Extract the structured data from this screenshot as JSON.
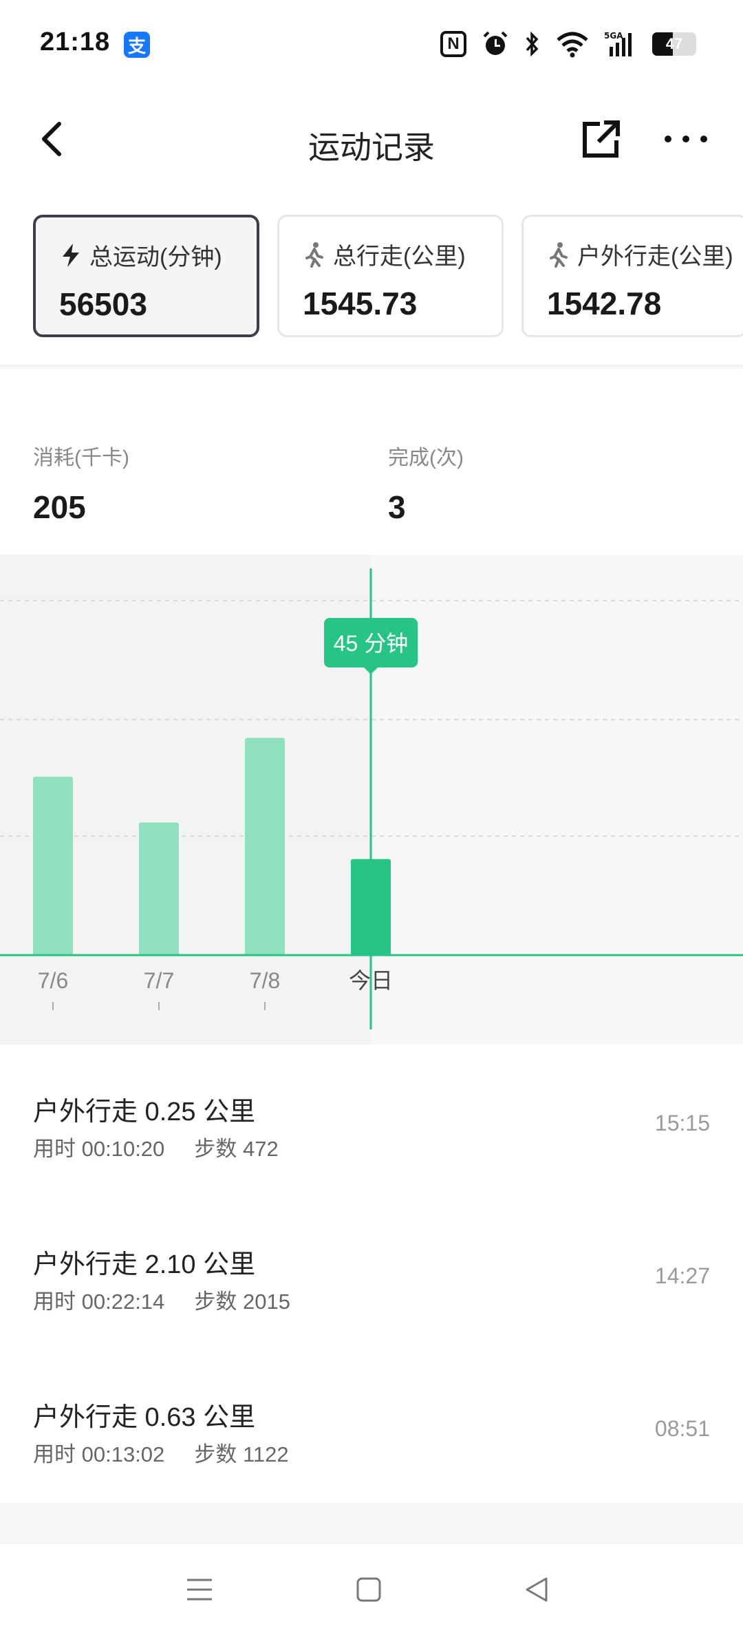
{
  "status_bar": {
    "time": "21:18",
    "app_badge": "支",
    "battery": "47",
    "battery_level": 0.47,
    "icons": [
      "nfc-icon",
      "alarm-icon",
      "bluetooth-icon",
      "wifi-icon",
      "signal-5g-icon",
      "battery-icon"
    ]
  },
  "header": {
    "title": "运动记录",
    "back_icon": "chevron-left-icon",
    "share_icon": "share-icon",
    "more_icon": "more-icon"
  },
  "cards": [
    {
      "icon": "lightning-icon",
      "label": "总运动(分钟)",
      "value": "56503",
      "selected": true
    },
    {
      "icon": "walk-icon",
      "label": "总行走(公里)",
      "value": "1545.73",
      "selected": false
    },
    {
      "icon": "walk-icon",
      "label": "户外行走(公里)",
      "value": "1542.78",
      "selected": false
    }
  ],
  "scrolled_value": "45",
  "metrics": [
    {
      "label": "消耗(千卡)",
      "value": "205"
    },
    {
      "label": "完成(次)",
      "value": "3"
    }
  ],
  "colors": {
    "accent": "#26c586",
    "bar_light": "#8fe0be",
    "text_primary": "#1a1a1a",
    "text_secondary": "#888888"
  },
  "chart_data": {
    "type": "bar",
    "categories": [
      "7/6",
      "7/7",
      "7/8",
      "今日"
    ],
    "values": [
      78,
      58,
      95,
      42
    ],
    "selected_index": 3,
    "tooltip": "45 分钟",
    "ylim": [
      0,
      145
    ],
    "gridlines": [
      52,
      103,
      155
    ],
    "grid": true
  },
  "activities": [
    {
      "title": "户外行走 0.25 公里",
      "duration": "用时 00:10:20",
      "steps": "步数 472",
      "time": "15:15"
    },
    {
      "title": "户外行走 2.10 公里",
      "duration": "用时 00:22:14",
      "steps": "步数 2015",
      "time": "14:27"
    },
    {
      "title": "户外行走 0.63 公里",
      "duration": "用时 00:13:02",
      "steps": "步数 1122",
      "time": "08:51"
    }
  ],
  "nav": {
    "icons": [
      "menu-icon",
      "home-square-icon",
      "back-triangle-icon"
    ]
  }
}
